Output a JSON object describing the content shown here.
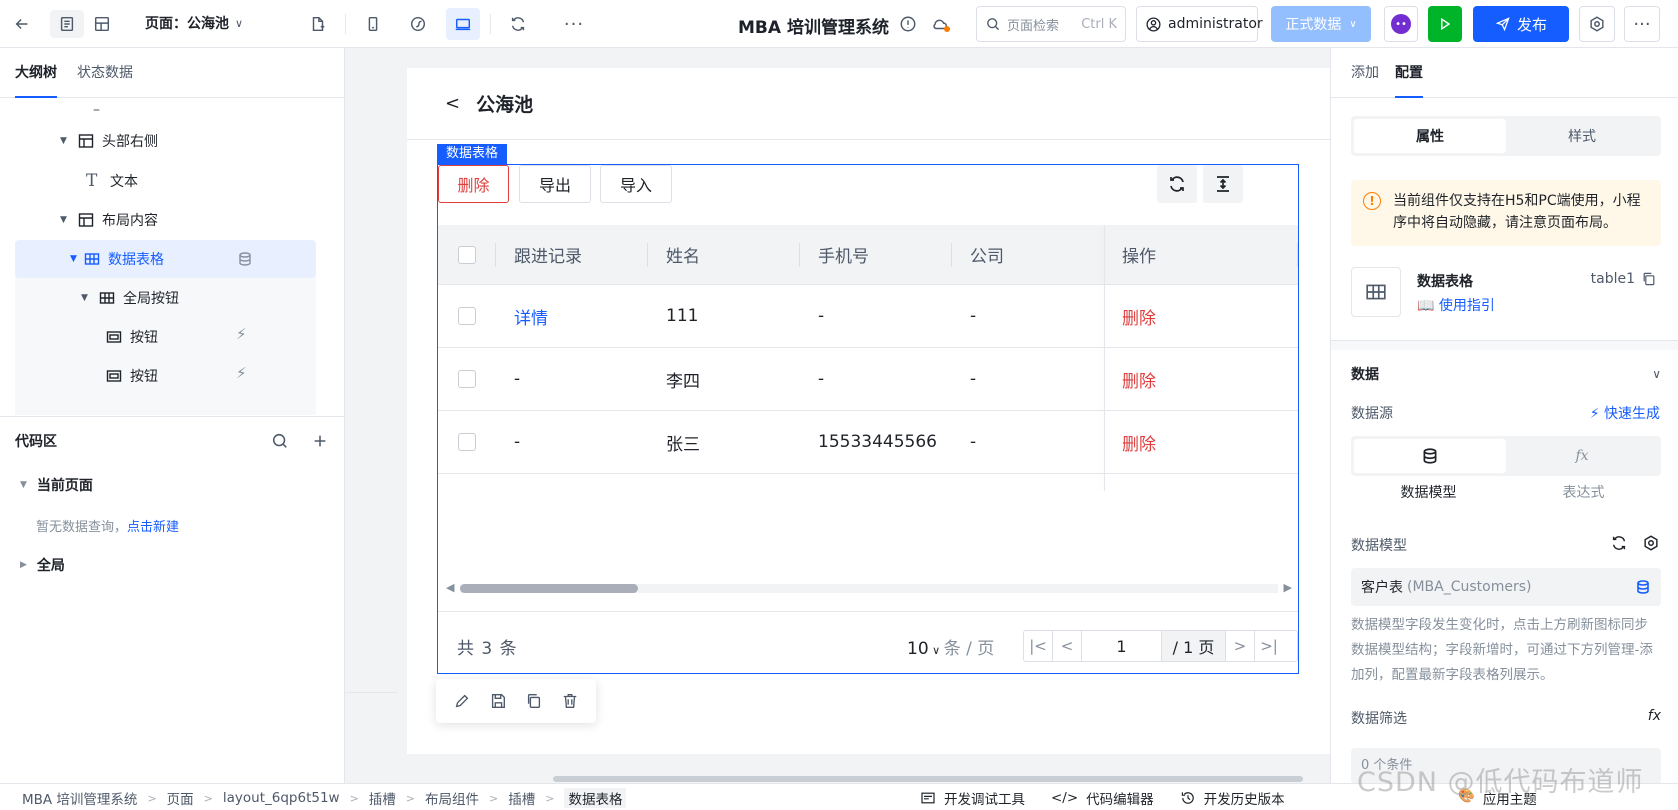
{
  "topbar": {
    "page_select": "页面：公海池",
    "app_title": "MBA 培训管理系统",
    "search_placeholder": "页面检索",
    "search_shortcut": "Ctrl K",
    "user": "administrator",
    "env": "正式数据",
    "publish": "发布"
  },
  "left": {
    "tabs": [
      "大纲树",
      "状态数据"
    ],
    "tree": {
      "dash": "–",
      "header_right": "头部右侧",
      "text": "文本",
      "layout_content": "布局内容",
      "data_table": "数据表格",
      "global_buttons": "全局按钮",
      "button1": "按钮",
      "button2": "按钮"
    },
    "code": {
      "title": "代码区",
      "current_page": "当前页面",
      "empty_prefix": "暂无数据查询，",
      "empty_link": "点击新建",
      "global": "全局"
    }
  },
  "canvas": {
    "page_title": "公海池",
    "component_label": "数据表格",
    "toolbar": {
      "delete": "删除",
      "export": "导出",
      "import": "导入"
    },
    "columns": [
      "跟进记录",
      "姓名",
      "手机号",
      "公司",
      "操作"
    ],
    "rows": [
      {
        "record": "详情",
        "name": "111",
        "phone": "-",
        "company": "-",
        "action": "删除"
      },
      {
        "record": "-",
        "name": "李四",
        "phone": "-",
        "company": "-",
        "action": "删除"
      },
      {
        "record": "-",
        "name": "张三",
        "phone": "15533445566",
        "company": "-",
        "action": "删除"
      }
    ],
    "pagination": {
      "total": "共  3  条",
      "page_size": "10",
      "page_size_unit": "条 / 页",
      "current_page": "1",
      "of_pages": "/ 1 页"
    }
  },
  "right": {
    "tabs": [
      "添加",
      "配置"
    ],
    "seg": [
      "属性",
      "样式"
    ],
    "warning": "当前组件仅支持在H5和PC端使用，小程序中将自动隐藏，请注意页面布局。",
    "component_name": "数据表格",
    "component_id": "table1",
    "guide": "使用指引",
    "data_section": "数据",
    "datasource_label": "数据源",
    "quick_generate": "快速生成",
    "ds_options": [
      "数据模型",
      "表达式"
    ],
    "data_model_label": "数据模型",
    "data_model_value": "客户表",
    "data_model_sub": "(MBA_Customers)",
    "help_text": "数据模型字段发生变化时，点击上方刷新图标同步数据模型结构；字段新增时，可通过下方列管理-添加列，配置最新字段表格列展示。",
    "filter_label": "数据筛选",
    "filter_value": "0 个条件"
  },
  "statusbar": {
    "crumbs": [
      "MBA 培训管理系统",
      "页面",
      "layout_6qp6t51w",
      "插槽",
      "布局组件",
      "插槽",
      "数据表格"
    ],
    "dev_tools": "开发调试工具",
    "code_editor": "代码编辑器",
    "history": "开发历史版本",
    "theme": "应用主题"
  },
  "watermark": "CSDN @低代码布道师",
  "colors": {
    "primary": "#165dff",
    "danger": "#e03e3e",
    "success": "#00b42a",
    "warning": "#ff7d00"
  }
}
